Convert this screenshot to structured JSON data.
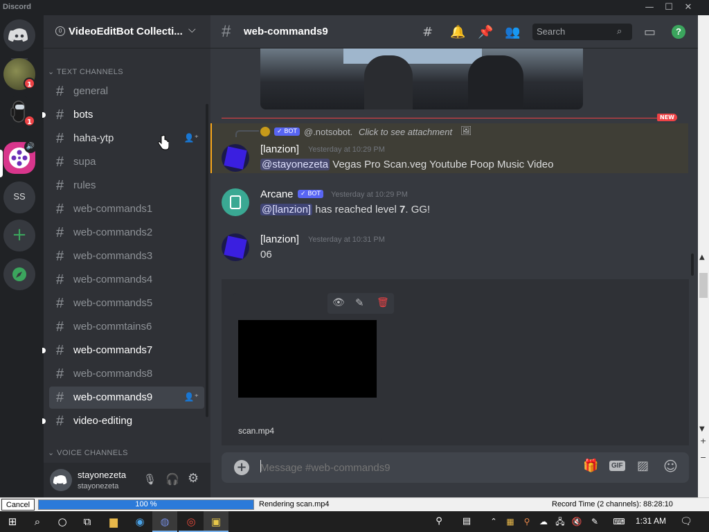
{
  "titlebar": {
    "app_name": "Discord"
  },
  "guild": {
    "name": "VideoEditBot Collecti..."
  },
  "servers": [
    {
      "name": "server-1",
      "badge": "1"
    },
    {
      "name": "server-2",
      "badge": "1"
    },
    {
      "name": "server-3"
    },
    {
      "name": "SS",
      "label": "SS"
    }
  ],
  "categories": {
    "text": "TEXT CHANNELS",
    "voice": "VOICE CHANNELS"
  },
  "channels": [
    {
      "label": "general"
    },
    {
      "label": "bots"
    },
    {
      "label": "haha-ytp"
    },
    {
      "label": "supa"
    },
    {
      "label": "rules"
    },
    {
      "label": "web-commands1"
    },
    {
      "label": "web-commands2"
    },
    {
      "label": "web-commands3"
    },
    {
      "label": "web-commands4"
    },
    {
      "label": "web-commands5"
    },
    {
      "label": "web-commtains6"
    },
    {
      "label": "web-commands7"
    },
    {
      "label": "web-commands8"
    },
    {
      "label": "web-commands9"
    },
    {
      "label": "video-editing"
    }
  ],
  "user": {
    "name": "stayonezeta",
    "tag": "stayonezeta"
  },
  "header": {
    "channel": "web-commands9",
    "search_placeholder": "Search"
  },
  "new_divider": "NEW",
  "reply": {
    "badge": "✓ BOT",
    "text": "@.notsobot.",
    "hint": "Click to see attachment"
  },
  "messages": [
    {
      "author": "[lanzion]",
      "timestamp": "Yesterday at 10:29 PM",
      "mention": "@stayonezeta",
      "text": " Vegas Pro Scan.veg Youtube Poop Music Video"
    },
    {
      "author": "Arcane",
      "bot_badge": "✓ BOT",
      "timestamp": "Yesterday at 10:29 PM",
      "mention": "@[lanzion]",
      "text_a": " has reached level ",
      "level": "7",
      "text_b": ". GG!"
    },
    {
      "author": "[lanzion]",
      "timestamp": "Yesterday at 10:31 PM",
      "text": "06"
    }
  ],
  "attachment": {
    "filename": "scan.mp4"
  },
  "composer": {
    "placeholder": "Message #web-commands9",
    "gif": "GIF"
  },
  "render": {
    "cancel": "Cancel",
    "progress_text": "100 %",
    "progress": 1.0,
    "status": "Rendering scan.mp4",
    "record_time": "Record Time (2 channels): 88:28:10"
  },
  "taskbar": {
    "time": "1:31 AM"
  },
  "colors": {
    "blurple": "#5865f2",
    "red": "#ed4245",
    "green": "#3ba55d",
    "progress": "#2b7ad9"
  }
}
